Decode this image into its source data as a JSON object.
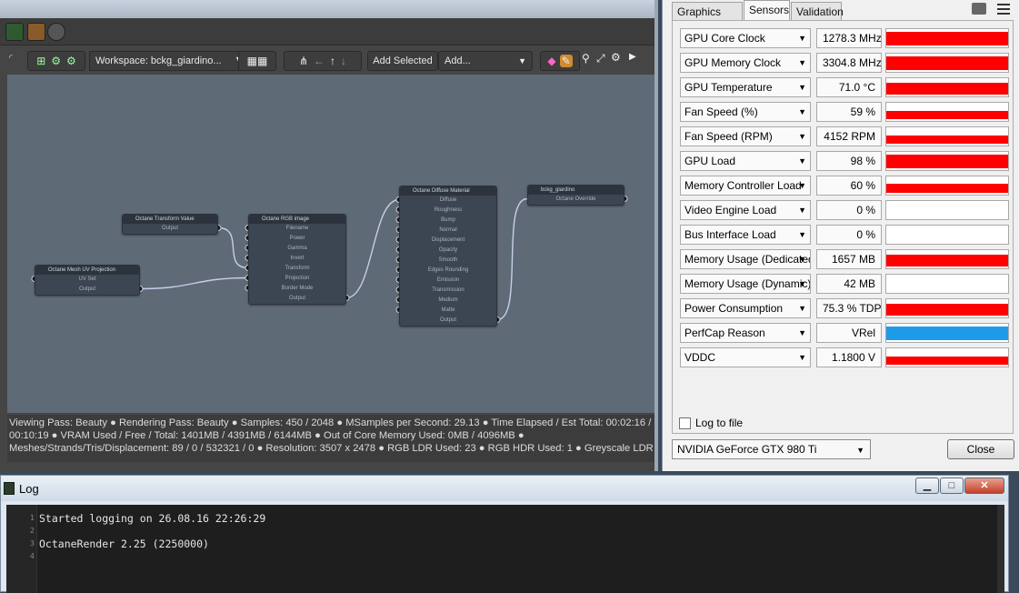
{
  "octane": {
    "toolbar": {
      "workspace": "Workspace: bckg_giardino...",
      "add_selected": "Add Selected",
      "add": "Add..."
    },
    "nodes": [
      {
        "id": "uv",
        "title": "Octane Mesh UV Projection",
        "pins": [
          "UV Set",
          "Output"
        ]
      },
      {
        "id": "transform",
        "title": "Octane Transform Value",
        "pins": [
          "Output"
        ]
      },
      {
        "id": "rgb",
        "title": "Octane RGB image",
        "pins": [
          "Filename",
          "Power",
          "Gamma",
          "Invert",
          "Transform",
          "Projection",
          "Border Mode",
          "Output"
        ]
      },
      {
        "id": "diffuse",
        "title": "Octane Diffuse Material",
        "pins": [
          "Diffuse",
          "Roughness",
          "Bump",
          "Normal",
          "Displacement",
          "Opacity",
          "Smooth",
          "Edges Rounding",
          "Emission",
          "Transmission",
          "Medium",
          "Matte",
          "Output"
        ]
      },
      {
        "id": "bckg",
        "title": "bckg_giardino",
        "pins": [
          "Octane Override"
        ]
      }
    ],
    "status": {
      "line1": "Viewing Pass: Beauty ● Rendering Pass: Beauty ● Samples: 450  / 2048 ● MSamples per Second: 29.13 ● Time Elapsed / Est Total: 00:02:16 /",
      "line2": "00:10:19 ● VRAM Used / Free / Total: 1401MB / 4391MB / 6144MB ● Out of Core Memory Used: 0MB / 4096MB ●",
      "line3": "Meshes/Strands/Tris/Displacement: 89 / 0 / 532321 / 0 ● Resolution: 3507 x 2478 ● RGB LDR Used: 23 ● RGB HDR Used: 1 ● Greyscale LDR ..."
    }
  },
  "gpuz": {
    "tabs": [
      "Graphics Card",
      "Sensors",
      "Validation"
    ],
    "active_tab": "Sensors",
    "sensors": [
      {
        "name": "GPU Core Clock",
        "value": "1278.3 MHz",
        "level": 0.85,
        "color": "#ff0000"
      },
      {
        "name": "GPU Memory Clock",
        "value": "3304.8 MHz",
        "level": 0.85,
        "color": "#ff0000"
      },
      {
        "name": "GPU Temperature",
        "value": "71.0 °C",
        "level": 0.7,
        "color": "#ff0000"
      },
      {
        "name": "Fan Speed (%)",
        "value": "59 %",
        "level": 0.5,
        "color": "#ff0000"
      },
      {
        "name": "Fan Speed (RPM)",
        "value": "4152 RPM",
        "level": 0.5,
        "color": "#ff0000"
      },
      {
        "name": "GPU Load",
        "value": "98 %",
        "level": 0.85,
        "color": "#ff0000"
      },
      {
        "name": "Memory Controller Load",
        "value": "60 %",
        "level": 0.55,
        "color": "#ff0000"
      },
      {
        "name": "Video Engine Load",
        "value": "0 %",
        "level": 0,
        "color": "#ff0000"
      },
      {
        "name": "Bus Interface Load",
        "value": "0 %",
        "level": 0,
        "color": "#ff0000"
      },
      {
        "name": "Memory Usage (Dedicated)",
        "value": "1657 MB",
        "level": 0.7,
        "color": "#ff0000"
      },
      {
        "name": "Memory Usage (Dynamic)",
        "value": "42 MB",
        "level": 0,
        "color": "#ff0000"
      },
      {
        "name": "Power Consumption",
        "value": "75.3 % TDP",
        "level": 0.7,
        "color": "#ff0000"
      },
      {
        "name": "PerfCap Reason",
        "value": "VRel",
        "level": 0.85,
        "color": "#1e9be8"
      },
      {
        "name": "VDDC",
        "value": "1.1800 V",
        "level": 0.5,
        "color": "#ff0000"
      }
    ],
    "log_to_file": "Log to file",
    "gpu": "NVIDIA GeForce GTX 980 Ti",
    "close": "Close"
  },
  "log": {
    "title": "Log",
    "lines": [
      {
        "n": "1",
        "text": "Started logging on 26.08.16 22:26:29"
      },
      {
        "n": "2",
        "text": ""
      },
      {
        "n": "3",
        "text": "OctaneRender 2.25 (2250000)"
      },
      {
        "n": "4",
        "text": ""
      }
    ]
  }
}
